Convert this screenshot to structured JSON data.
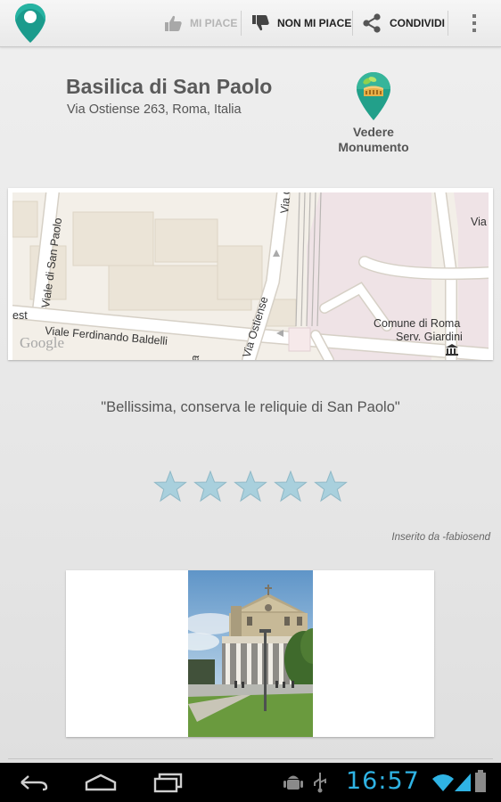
{
  "actionbar": {
    "like_label": "MI PIACE",
    "dislike_label": "NON MI PIACE",
    "share_label": "CONDIVIDI"
  },
  "poi": {
    "name": "Basilica di San Paolo",
    "address": "Via Ostiense 263, Roma, Italia",
    "view_monument_label": "Vedere Monumento"
  },
  "map": {
    "streets": {
      "viale_san_paolo": "Viale di San Paolo",
      "via_ostiense": "Via Ostiense",
      "via_ostiense_top": "Via O",
      "viale_baldelli": "Viale Ferdinando Baldelli",
      "via_right": "Via",
      "est": "est",
      "a_label": "a"
    },
    "poi_label_1": "Comune di Roma",
    "poi_label_2": "Serv. Giardini",
    "attribution": "Google"
  },
  "review": {
    "quote": "\"Bellissima, conserva le reliquie di San Paolo\"",
    "rating": 5,
    "rating_max": 5,
    "author": "Inserito da -fabiosend"
  },
  "status": {
    "time": "16:57"
  },
  "colors": {
    "brand_green": "#1b9b8c",
    "star_fill": "#a9d0dd",
    "clock": "#2fb3e4"
  },
  "icons": {
    "logo": "map-pin-logo-icon",
    "like": "thumbs-up-icon",
    "dislike": "thumbs-down-icon",
    "share": "share-icon",
    "overflow": "overflow-menu-icon",
    "monument": "colosseum-pin-icon",
    "back": "back-icon",
    "home": "home-icon",
    "recents": "recent-apps-icon",
    "android": "android-debug-icon",
    "usb": "usb-icon",
    "wifi": "wifi-icon",
    "signal": "signal-icon",
    "battery": "battery-icon"
  }
}
